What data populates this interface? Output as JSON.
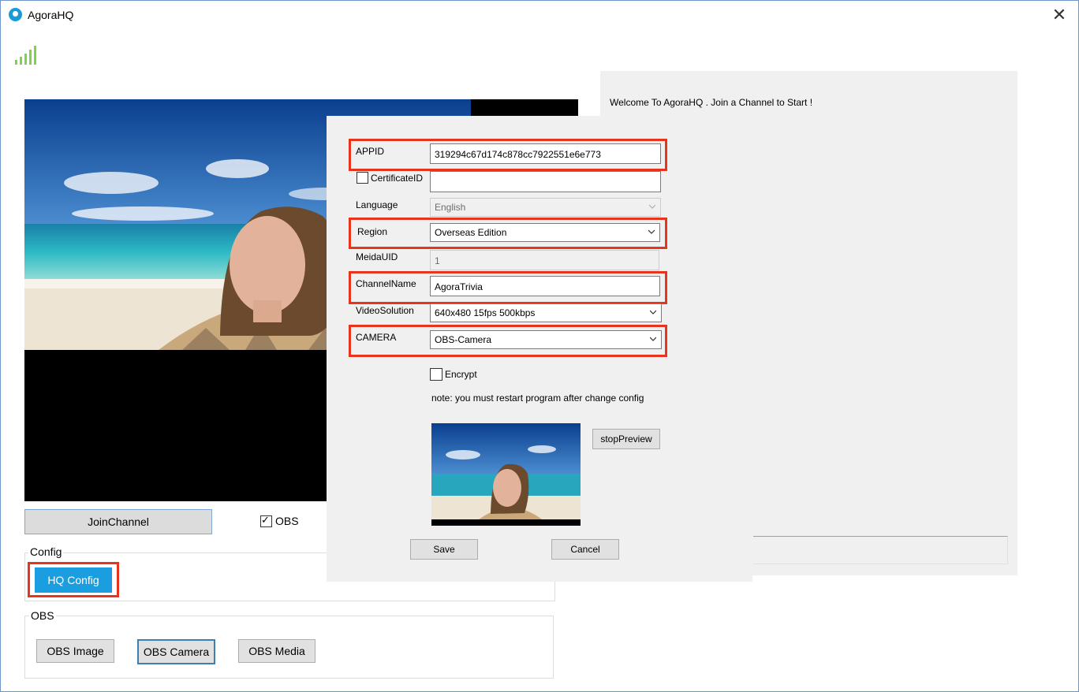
{
  "window": {
    "title": "AgoraHQ",
    "close_glyph": "✕"
  },
  "main": {
    "join_button": "JoinChannel",
    "obs_checkbox_label": "OBS",
    "obs_checked": true,
    "config_group": {
      "title": "Config",
      "hq_config_button": "HQ Config"
    },
    "obs_group": {
      "title": "OBS",
      "buttons": [
        "OBS Image",
        "OBS Camera",
        "OBS Media"
      ]
    }
  },
  "right_panel": {
    "welcome": "Welcome To AgoraHQ . Join a Channel to Start !"
  },
  "dialog": {
    "appid": {
      "label": "APPID",
      "value": "319294c67d174c878cc7922551e6e773"
    },
    "certificate": {
      "label": "CertificateID",
      "value": "",
      "checked": false
    },
    "language": {
      "label": "Language",
      "value": "English"
    },
    "region": {
      "label": "Region",
      "value": "Overseas Edition"
    },
    "mediauid": {
      "label": "MeidaUID",
      "value": "1"
    },
    "channel": {
      "label": "ChannelName",
      "value": "AgoraTrivia"
    },
    "video": {
      "label": "VideoSolution",
      "value": "640x480 15fps 500kbps"
    },
    "camera": {
      "label": "CAMERA",
      "value": "OBS-Camera"
    },
    "encrypt": {
      "label": "Encrypt",
      "checked": false
    },
    "note": "note: you must restart program after change config",
    "stop_preview_button": "stopPreview",
    "save_button": "Save",
    "cancel_button": "Cancel"
  },
  "colors": {
    "accent": "#1a9ee0",
    "highlight": "#e8341c",
    "signal": "#7bd44a"
  },
  "icons": {
    "app": "agora-eye-icon",
    "signal": "signal-bars-icon",
    "close": "close-icon",
    "chevron": "chevron-down-icon"
  }
}
